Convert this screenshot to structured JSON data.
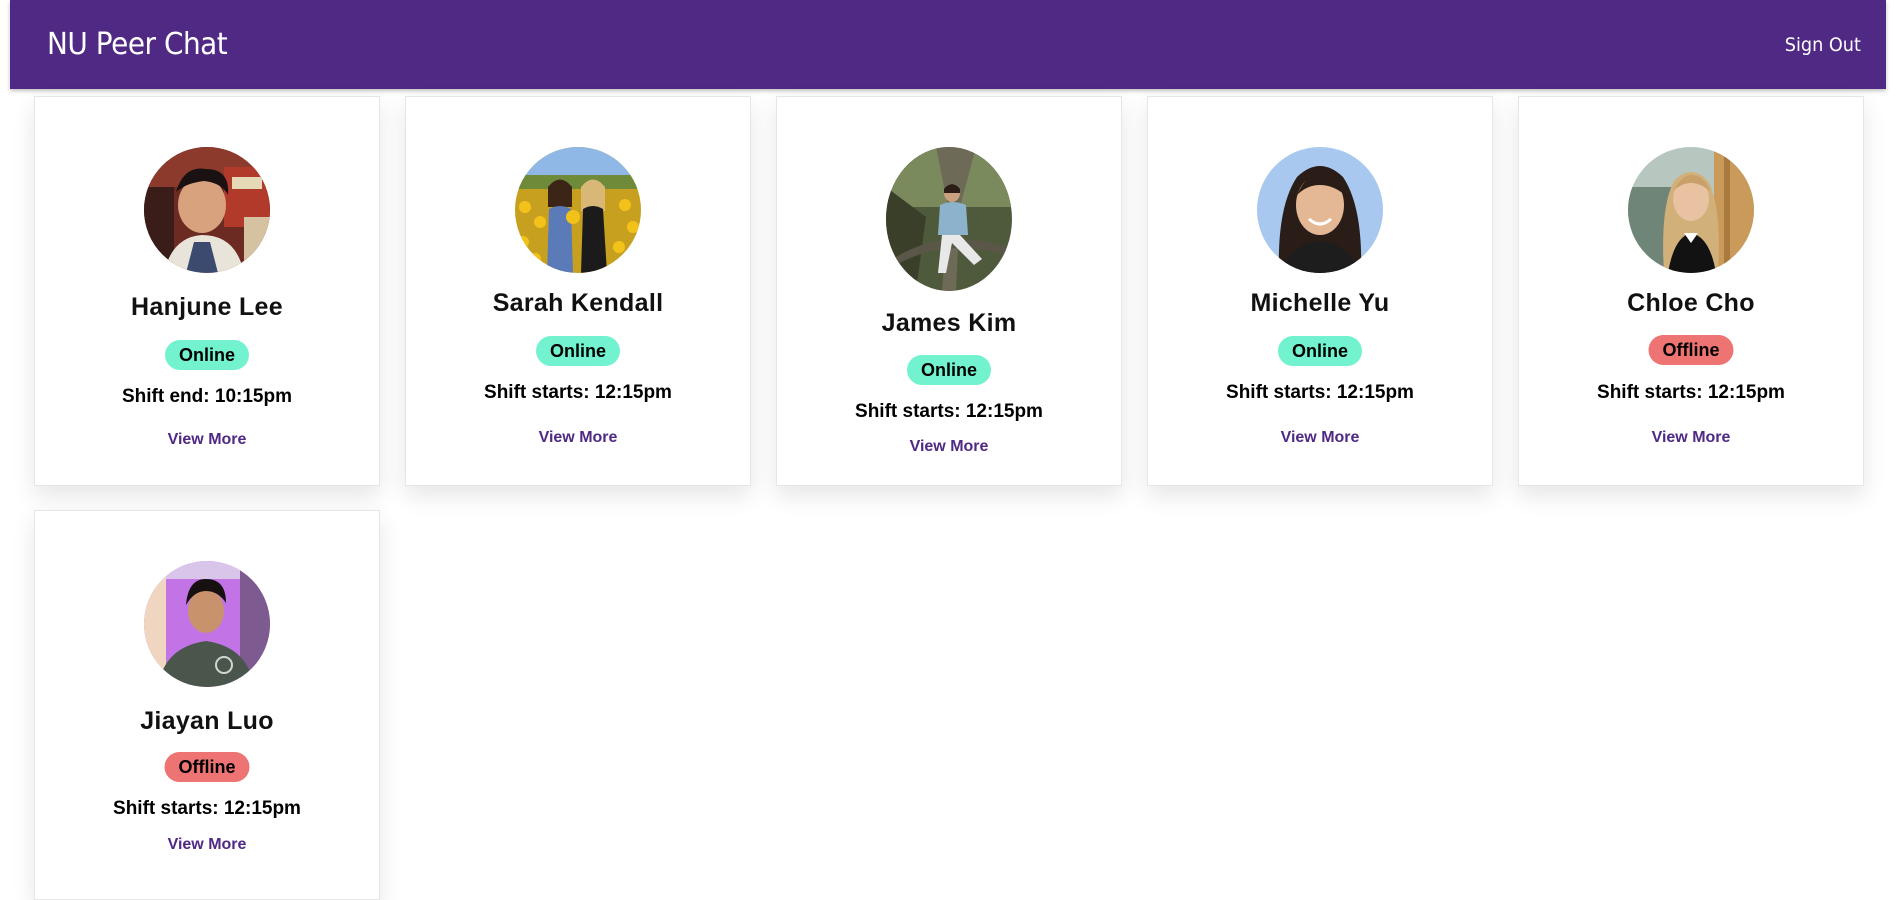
{
  "app": {
    "title": "NU Peer Chat",
    "sign_out_label": "Sign Out"
  },
  "colors": {
    "header": "#4f2984",
    "online": "#73f2cf",
    "offline": "#ee7373",
    "link": "#4f2984"
  },
  "peers": [
    {
      "name": "Hanjune Lee",
      "status": "Online",
      "shift": "Shift end: 10:15pm",
      "action": "View More"
    },
    {
      "name": "Sarah Kendall",
      "status": "Online",
      "shift": "Shift starts: 12:15pm",
      "action": "View More"
    },
    {
      "name": "James Kim",
      "status": "Online",
      "shift": "Shift starts: 12:15pm",
      "action": "View More"
    },
    {
      "name": "Michelle Yu",
      "status": "Online",
      "shift": "Shift starts: 12:15pm",
      "action": "View More"
    },
    {
      "name": "Chloe Cho",
      "status": "Offline",
      "shift": "Shift starts: 12:15pm",
      "action": "View More"
    },
    {
      "name": "Jiayan Luo",
      "status": "Offline",
      "shift": "Shift starts: 12:15pm",
      "action": "View More"
    }
  ]
}
